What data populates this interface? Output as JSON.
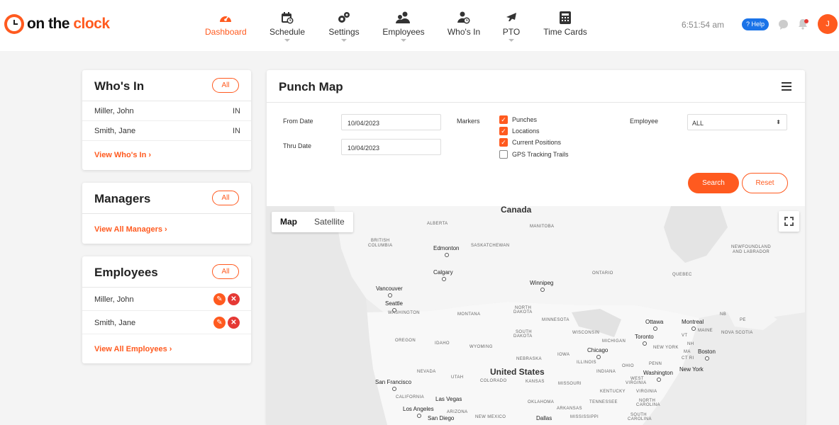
{
  "brand": {
    "part1": "on the ",
    "part2": "clock"
  },
  "colors": {
    "accent": "#ff5a1f",
    "help": "#1a73e8",
    "danger": "#e53935"
  },
  "nav": {
    "items": [
      {
        "label": "Dashboard",
        "icon": "dashboard-gauge-icon",
        "active": true
      },
      {
        "label": "Schedule",
        "icon": "calendar-clock-icon"
      },
      {
        "label": "Settings",
        "icon": "gears-icon"
      },
      {
        "label": "Employees",
        "icon": "people-icon"
      },
      {
        "label": "Who's In",
        "icon": "person-clock-icon"
      },
      {
        "label": "PTO",
        "icon": "airplane-icon"
      },
      {
        "label": "Time Cards",
        "icon": "calculator-icon"
      }
    ]
  },
  "header": {
    "time": "6:51:54 am",
    "help": "? Help",
    "avatar": "J"
  },
  "whos_in": {
    "title": "Who's In",
    "all": "All",
    "rows": [
      {
        "name": "Miller, John",
        "status": "IN"
      },
      {
        "name": "Smith, Jane",
        "status": "IN"
      }
    ],
    "link": "View Who's In ›"
  },
  "managers": {
    "title": "Managers",
    "all": "All",
    "link": "View All Managers ›"
  },
  "employees": {
    "title": "Employees",
    "all": "All",
    "rows": [
      {
        "name": "Miller, John"
      },
      {
        "name": "Smith, Jane"
      }
    ],
    "link": "View All Employees ›"
  },
  "punch_map": {
    "title": "Punch Map",
    "from_label": "From Date",
    "from_value": "10/04/2023",
    "thru_label": "Thru Date",
    "thru_value": "10/04/2023",
    "markers_label": "Markers",
    "markers": [
      {
        "label": "Punches",
        "checked": true
      },
      {
        "label": "Locations",
        "checked": true
      },
      {
        "label": "Current Positions",
        "checked": true
      },
      {
        "label": "GPS Tracking Trails",
        "checked": false
      }
    ],
    "employee_label": "Employee",
    "employee_value": "ALL",
    "search": "Search",
    "reset": "Reset",
    "map_tab": "Map",
    "satellite_tab": "Satellite"
  },
  "map_labels": {
    "canada": "Canada",
    "us": "United States",
    "alberta": "ALBERTA",
    "manitoba": "MANITOBA",
    "bc1": "BRITISH",
    "bc2": "COLUMBIA",
    "saskatchewan": "SASKATCHEWAN",
    "edmonton": "Edmonton",
    "nl1": "NEWFOUNDLAND",
    "nl2": "AND LABRADOR",
    "calgary": "Calgary",
    "ontario": "ONTARIO",
    "quebec": "QUEBEC",
    "vancouver": "Vancouver",
    "winnipeg": "Winnipeg",
    "seattle": "Seattle",
    "washington": "WASHINGTON",
    "montana": "MONTANA",
    "nd1": "NORTH",
    "nd2": "DAKOTA",
    "minnesota": "MINNESOTA",
    "ottawa": "Ottawa",
    "montreal": "Montreal",
    "nb": "NB",
    "pe": "PE",
    "sd1": "SOUTH",
    "sd2": "DAKOTA",
    "wisconsin": "WISCONSIN",
    "toronto": "Toronto",
    "maine": "MAINE",
    "novascotia": "NOVA SCOTIA",
    "vt": "VT",
    "oregon": "OREGON",
    "idaho": "IDAHO",
    "wyoming": "WYOMING",
    "michigan": "MICHIGAN",
    "newyork": "NEW YORK",
    "nh": "NH",
    "ma": "MA",
    "boston": "Boston",
    "ct": "CT RI",
    "chicago": "Chicago",
    "iowa": "IOWA",
    "nebraska": "NEBRASKA",
    "illinois": "ILLINOIS",
    "ohio": "OHIO",
    "penn": "PENN",
    "nyc": "New York",
    "nevada": "NEVADA",
    "utah": "UTAH",
    "colorado": "COLORADO",
    "kansas": "KANSAS",
    "missouri": "MISSOURI",
    "indiana": "INDIANA",
    "wv1": "WEST",
    "wv2": "VIRGINIA",
    "dc": "Washington",
    "sf": "San Francisco",
    "kentucky": "KENTUCKY",
    "virginia": "VIRGINIA",
    "california": "CALIFORNIA",
    "lasvegas": "Las Vegas",
    "oklahoma": "OKLAHOMA",
    "tennessee": "TENNESSEE",
    "nc1": "NORTH",
    "nc2": "CAROLINA",
    "la": "Los Angeles",
    "arizona": "ARIZONA",
    "arkansas": "ARKANSAS",
    "sandiego": "San Diego",
    "newmexico": "NEW MEXICO",
    "dallas": "Dallas",
    "mississippi": "MISSISSIPPI",
    "sc1": "SOUTH",
    "sc2": "CAROLINA"
  }
}
